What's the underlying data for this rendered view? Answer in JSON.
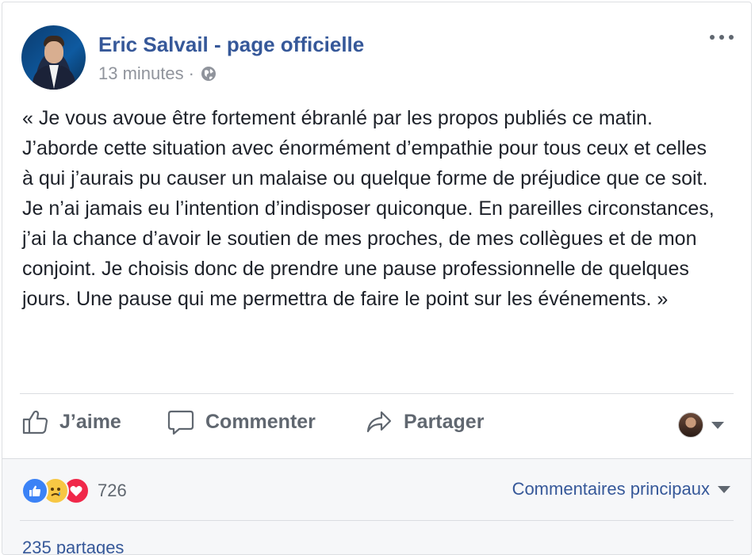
{
  "post": {
    "page_name": "Eric Salvail - page officielle",
    "time": "13 minutes",
    "separator": "·",
    "privacy_icon": "globe-icon",
    "more_icon": "more-dots-icon",
    "text": "« Je vous avoue être fortement ébranlé par les propos publiés ce matin. J’aborde cette situation avec énormément d’empathie pour tous ceux et celles à qui j’aurais pu causer un malaise ou quelque forme de préjudice que ce soit. Je n’ai jamais eu l’intention d’indisposer quiconque. En pareilles circonstances, j’ai la chance d’avoir le soutien de mes proches, de mes collègues et de mon conjoint. Je choisis donc de prendre une pause professionnelle de quelques jours. Une pause qui me permettra de faire le point sur les événements. »"
  },
  "actions": {
    "like_label": "J’aime",
    "comment_label": "Commenter",
    "share_label": "Partager"
  },
  "stats": {
    "reactions": [
      "like",
      "sad",
      "love"
    ],
    "reaction_count": "726",
    "sort_label": "Commentaires principaux",
    "shares": "235 partages"
  },
  "colors": {
    "link_blue": "#365899",
    "muted": "#90949c",
    "like_blue": "#3b82f6",
    "love_red": "#f0284a",
    "sad_yellow": "#f7c744"
  }
}
